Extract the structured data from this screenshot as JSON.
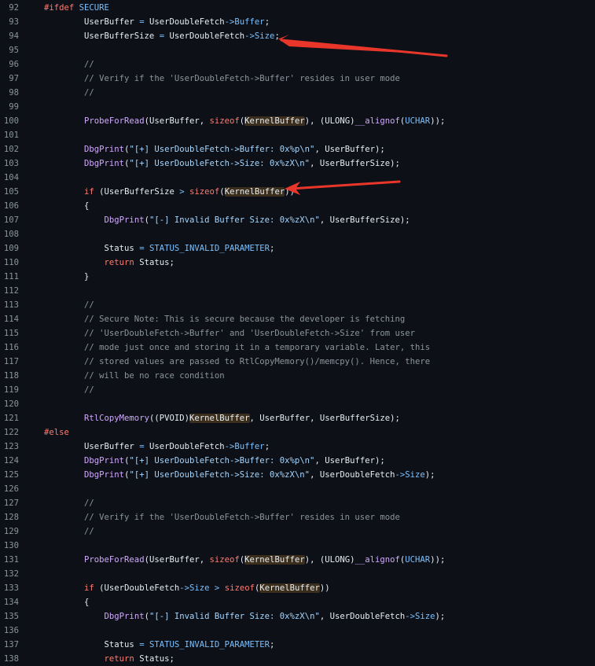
{
  "colors": {
    "background": "#0d1117",
    "line_number": "#8b949e",
    "keyword": "#ff7b72",
    "function": "#d2a8ff",
    "string": "#a5d6ff",
    "comment": "#8b949e",
    "constant": "#79c0ff",
    "annotation_arrow": "#e8362b"
  },
  "annotations": [
    {
      "kind": "red-arrow",
      "points_to_line": "94"
    },
    {
      "kind": "red-arrow",
      "points_to_line": "105"
    }
  ],
  "lines": [
    {
      "num": "92",
      "tokens": [
        {
          "t": "#ifdef ",
          "c": "kw"
        },
        {
          "t": "SECURE",
          "c": "const"
        }
      ]
    },
    {
      "num": "93",
      "tokens": [
        {
          "t": "        UserBuffer ",
          "c": "plain"
        },
        {
          "t": "=",
          "c": "op"
        },
        {
          "t": " UserDoubleFetch",
          "c": "plain"
        },
        {
          "t": "->",
          "c": "op"
        },
        {
          "t": "Buffer",
          "c": "const"
        },
        {
          "t": ";",
          "c": "plain"
        }
      ]
    },
    {
      "num": "94",
      "tokens": [
        {
          "t": "        UserBufferSize ",
          "c": "plain"
        },
        {
          "t": "=",
          "c": "op"
        },
        {
          "t": " UserDoubleFetch",
          "c": "plain"
        },
        {
          "t": "->",
          "c": "op"
        },
        {
          "t": "Size",
          "c": "const"
        },
        {
          "t": ";",
          "c": "plain"
        }
      ]
    },
    {
      "num": "95",
      "tokens": []
    },
    {
      "num": "96",
      "tokens": [
        {
          "t": "        //",
          "c": "cmt"
        }
      ]
    },
    {
      "num": "97",
      "tokens": [
        {
          "t": "        // Verify if the 'UserDoubleFetch->Buffer' resides in user mode",
          "c": "cmt"
        }
      ]
    },
    {
      "num": "98",
      "tokens": [
        {
          "t": "        //",
          "c": "cmt"
        }
      ]
    },
    {
      "num": "99",
      "tokens": []
    },
    {
      "num": "100",
      "tokens": [
        {
          "t": "        ",
          "c": "plain"
        },
        {
          "t": "ProbeForRead",
          "c": "fn"
        },
        {
          "t": "(UserBuffer, ",
          "c": "plain"
        },
        {
          "t": "sizeof",
          "c": "kw"
        },
        {
          "t": "(",
          "c": "plain"
        },
        {
          "t": "KernelBuffer",
          "c": "hl"
        },
        {
          "t": "), (ULONG)",
          "c": "plain"
        },
        {
          "t": "__alignof",
          "c": "fn"
        },
        {
          "t": "(",
          "c": "plain"
        },
        {
          "t": "UCHAR",
          "c": "const"
        },
        {
          "t": "));",
          "c": "plain"
        }
      ]
    },
    {
      "num": "101",
      "tokens": []
    },
    {
      "num": "102",
      "tokens": [
        {
          "t": "        ",
          "c": "plain"
        },
        {
          "t": "DbgPrint",
          "c": "fn"
        },
        {
          "t": "(",
          "c": "plain"
        },
        {
          "t": "\"[+] UserDoubleFetch->Buffer: 0x%p\\n\"",
          "c": "str"
        },
        {
          "t": ", UserBuffer);",
          "c": "plain"
        }
      ]
    },
    {
      "num": "103",
      "tokens": [
        {
          "t": "        ",
          "c": "plain"
        },
        {
          "t": "DbgPrint",
          "c": "fn"
        },
        {
          "t": "(",
          "c": "plain"
        },
        {
          "t": "\"[+] UserDoubleFetch->Size: 0x%zX\\n\"",
          "c": "str"
        },
        {
          "t": ", UserBufferSize);",
          "c": "plain"
        }
      ]
    },
    {
      "num": "104",
      "tokens": []
    },
    {
      "num": "105",
      "tokens": [
        {
          "t": "        ",
          "c": "plain"
        },
        {
          "t": "if",
          "c": "kw"
        },
        {
          "t": " (UserBufferSize ",
          "c": "plain"
        },
        {
          "t": ">",
          "c": "op"
        },
        {
          "t": " ",
          "c": "plain"
        },
        {
          "t": "sizeof",
          "c": "kw"
        },
        {
          "t": "(",
          "c": "plain"
        },
        {
          "t": "KernelBuffer",
          "c": "hl"
        },
        {
          "t": "))",
          "c": "plain"
        }
      ]
    },
    {
      "num": "106",
      "tokens": [
        {
          "t": "        {",
          "c": "plain"
        }
      ]
    },
    {
      "num": "107",
      "tokens": [
        {
          "t": "            ",
          "c": "plain"
        },
        {
          "t": "DbgPrint",
          "c": "fn"
        },
        {
          "t": "(",
          "c": "plain"
        },
        {
          "t": "\"[-] Invalid Buffer Size: 0x%zX\\n\"",
          "c": "str"
        },
        {
          "t": ", UserBufferSize);",
          "c": "plain"
        }
      ]
    },
    {
      "num": "108",
      "tokens": []
    },
    {
      "num": "109",
      "tokens": [
        {
          "t": "            Status ",
          "c": "plain"
        },
        {
          "t": "=",
          "c": "op"
        },
        {
          "t": " ",
          "c": "plain"
        },
        {
          "t": "STATUS_INVALID_PARAMETER",
          "c": "const"
        },
        {
          "t": ";",
          "c": "plain"
        }
      ]
    },
    {
      "num": "110",
      "tokens": [
        {
          "t": "            ",
          "c": "plain"
        },
        {
          "t": "return",
          "c": "kw"
        },
        {
          "t": " Status;",
          "c": "plain"
        }
      ]
    },
    {
      "num": "111",
      "tokens": [
        {
          "t": "        }",
          "c": "plain"
        }
      ]
    },
    {
      "num": "112",
      "tokens": []
    },
    {
      "num": "113",
      "tokens": [
        {
          "t": "        //",
          "c": "cmt"
        }
      ]
    },
    {
      "num": "114",
      "tokens": [
        {
          "t": "        // Secure Note: This is secure because the developer is fetching",
          "c": "cmt"
        }
      ]
    },
    {
      "num": "115",
      "tokens": [
        {
          "t": "        // 'UserDoubleFetch->Buffer' and 'UserDoubleFetch->Size' from user",
          "c": "cmt"
        }
      ]
    },
    {
      "num": "116",
      "tokens": [
        {
          "t": "        // mode just once and storing it in a temporary variable. Later, this",
          "c": "cmt"
        }
      ]
    },
    {
      "num": "117",
      "tokens": [
        {
          "t": "        // stored values are passed to RtlCopyMemory()/memcpy(). Hence, there",
          "c": "cmt"
        }
      ]
    },
    {
      "num": "118",
      "tokens": [
        {
          "t": "        // will be no race condition",
          "c": "cmt"
        }
      ]
    },
    {
      "num": "119",
      "tokens": [
        {
          "t": "        //",
          "c": "cmt"
        }
      ]
    },
    {
      "num": "120",
      "tokens": []
    },
    {
      "num": "121",
      "tokens": [
        {
          "t": "        ",
          "c": "plain"
        },
        {
          "t": "RtlCopyMemory",
          "c": "fn"
        },
        {
          "t": "((PVOID)",
          "c": "plain"
        },
        {
          "t": "KernelBuffer",
          "c": "hl"
        },
        {
          "t": ", UserBuffer, UserBufferSize);",
          "c": "plain"
        }
      ]
    },
    {
      "num": "122",
      "tokens": [
        {
          "t": "#else",
          "c": "kw"
        }
      ]
    },
    {
      "num": "123",
      "tokens": [
        {
          "t": "        UserBuffer ",
          "c": "plain"
        },
        {
          "t": "=",
          "c": "op"
        },
        {
          "t": " UserDoubleFetch",
          "c": "plain"
        },
        {
          "t": "->",
          "c": "op"
        },
        {
          "t": "Buffer",
          "c": "const"
        },
        {
          "t": ";",
          "c": "plain"
        }
      ]
    },
    {
      "num": "124",
      "tokens": [
        {
          "t": "        ",
          "c": "plain"
        },
        {
          "t": "DbgPrint",
          "c": "fn"
        },
        {
          "t": "(",
          "c": "plain"
        },
        {
          "t": "\"[+] UserDoubleFetch->Buffer: 0x%p\\n\"",
          "c": "str"
        },
        {
          "t": ", UserBuffer);",
          "c": "plain"
        }
      ]
    },
    {
      "num": "125",
      "tokens": [
        {
          "t": "        ",
          "c": "plain"
        },
        {
          "t": "DbgPrint",
          "c": "fn"
        },
        {
          "t": "(",
          "c": "plain"
        },
        {
          "t": "\"[+] UserDoubleFetch->Size: 0x%zX\\n\"",
          "c": "str"
        },
        {
          "t": ", UserDoubleFetch",
          "c": "plain"
        },
        {
          "t": "->",
          "c": "op"
        },
        {
          "t": "Size",
          "c": "const"
        },
        {
          "t": ");",
          "c": "plain"
        }
      ]
    },
    {
      "num": "126",
      "tokens": []
    },
    {
      "num": "127",
      "tokens": [
        {
          "t": "        //",
          "c": "cmt"
        }
      ]
    },
    {
      "num": "128",
      "tokens": [
        {
          "t": "        // Verify if the 'UserDoubleFetch->Buffer' resides in user mode",
          "c": "cmt"
        }
      ]
    },
    {
      "num": "129",
      "tokens": [
        {
          "t": "        //",
          "c": "cmt"
        }
      ]
    },
    {
      "num": "130",
      "tokens": []
    },
    {
      "num": "131",
      "tokens": [
        {
          "t": "        ",
          "c": "plain"
        },
        {
          "t": "ProbeForRead",
          "c": "fn"
        },
        {
          "t": "(UserBuffer, ",
          "c": "plain"
        },
        {
          "t": "sizeof",
          "c": "kw"
        },
        {
          "t": "(",
          "c": "plain"
        },
        {
          "t": "KernelBuffer",
          "c": "hl"
        },
        {
          "t": "), (ULONG)",
          "c": "plain"
        },
        {
          "t": "__alignof",
          "c": "fn"
        },
        {
          "t": "(",
          "c": "plain"
        },
        {
          "t": "UCHAR",
          "c": "const"
        },
        {
          "t": "));",
          "c": "plain"
        }
      ]
    },
    {
      "num": "132",
      "tokens": []
    },
    {
      "num": "133",
      "tokens": [
        {
          "t": "        ",
          "c": "plain"
        },
        {
          "t": "if",
          "c": "kw"
        },
        {
          "t": " (UserDoubleFetch",
          "c": "plain"
        },
        {
          "t": "->",
          "c": "op"
        },
        {
          "t": "Size",
          "c": "const"
        },
        {
          "t": " ",
          "c": "plain"
        },
        {
          "t": ">",
          "c": "op"
        },
        {
          "t": " ",
          "c": "plain"
        },
        {
          "t": "sizeof",
          "c": "kw"
        },
        {
          "t": "(",
          "c": "plain"
        },
        {
          "t": "KernelBuffer",
          "c": "hl"
        },
        {
          "t": "))",
          "c": "plain"
        }
      ]
    },
    {
      "num": "134",
      "tokens": [
        {
          "t": "        {",
          "c": "plain"
        }
      ]
    },
    {
      "num": "135",
      "tokens": [
        {
          "t": "            ",
          "c": "plain"
        },
        {
          "t": "DbgPrint",
          "c": "fn"
        },
        {
          "t": "(",
          "c": "plain"
        },
        {
          "t": "\"[-] Invalid Buffer Size: 0x%zX\\n\"",
          "c": "str"
        },
        {
          "t": ", UserDoubleFetch",
          "c": "plain"
        },
        {
          "t": "->",
          "c": "op"
        },
        {
          "t": "Size",
          "c": "const"
        },
        {
          "t": ");",
          "c": "plain"
        }
      ]
    },
    {
      "num": "136",
      "tokens": []
    },
    {
      "num": "137",
      "tokens": [
        {
          "t": "            Status ",
          "c": "plain"
        },
        {
          "t": "=",
          "c": "op"
        },
        {
          "t": " ",
          "c": "plain"
        },
        {
          "t": "STATUS_INVALID_PARAMETER",
          "c": "const"
        },
        {
          "t": ";",
          "c": "plain"
        }
      ]
    },
    {
      "num": "138",
      "tokens": [
        {
          "t": "            ",
          "c": "plain"
        },
        {
          "t": "return",
          "c": "kw"
        },
        {
          "t": " Status;",
          "c": "plain"
        }
      ]
    }
  ]
}
